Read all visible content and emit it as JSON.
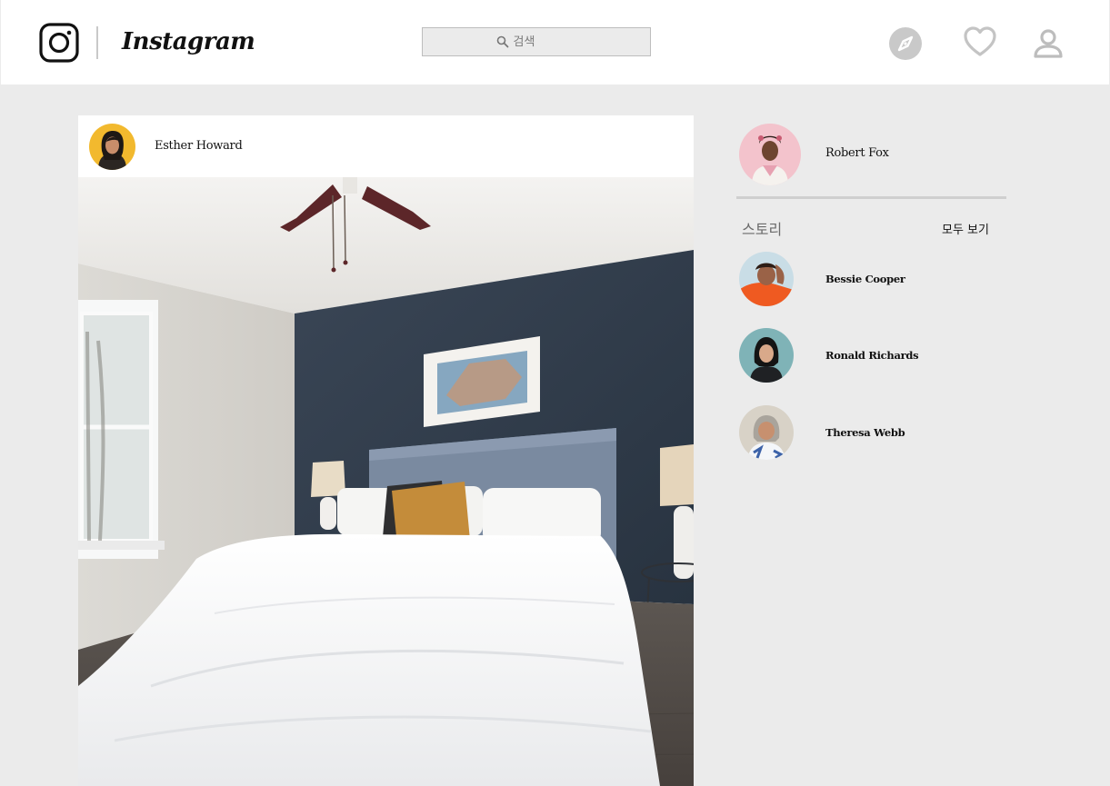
{
  "header": {
    "brand": "Instagram",
    "search": {
      "placeholder": "검색",
      "value": ""
    },
    "icons": [
      "instagram-logo-icon",
      "search-icon",
      "explore-icon",
      "heart-icon",
      "profile-icon"
    ]
  },
  "post": {
    "author": "Esther Howard",
    "image": "bedroom-photo"
  },
  "sidebar": {
    "current_user": "Robert Fox",
    "stories_title": "스토리",
    "see_all_label": "모두 보기",
    "stories": [
      {
        "name": "Bessie Cooper"
      },
      {
        "name": "Ronald Richards"
      },
      {
        "name": "Theresa Webb"
      }
    ]
  },
  "colors": {
    "background": "#ebebeb",
    "header": "#ffffff",
    "text": "#111111",
    "muted": "#6b6b6b",
    "wall_accent": "#2f3b4a"
  }
}
